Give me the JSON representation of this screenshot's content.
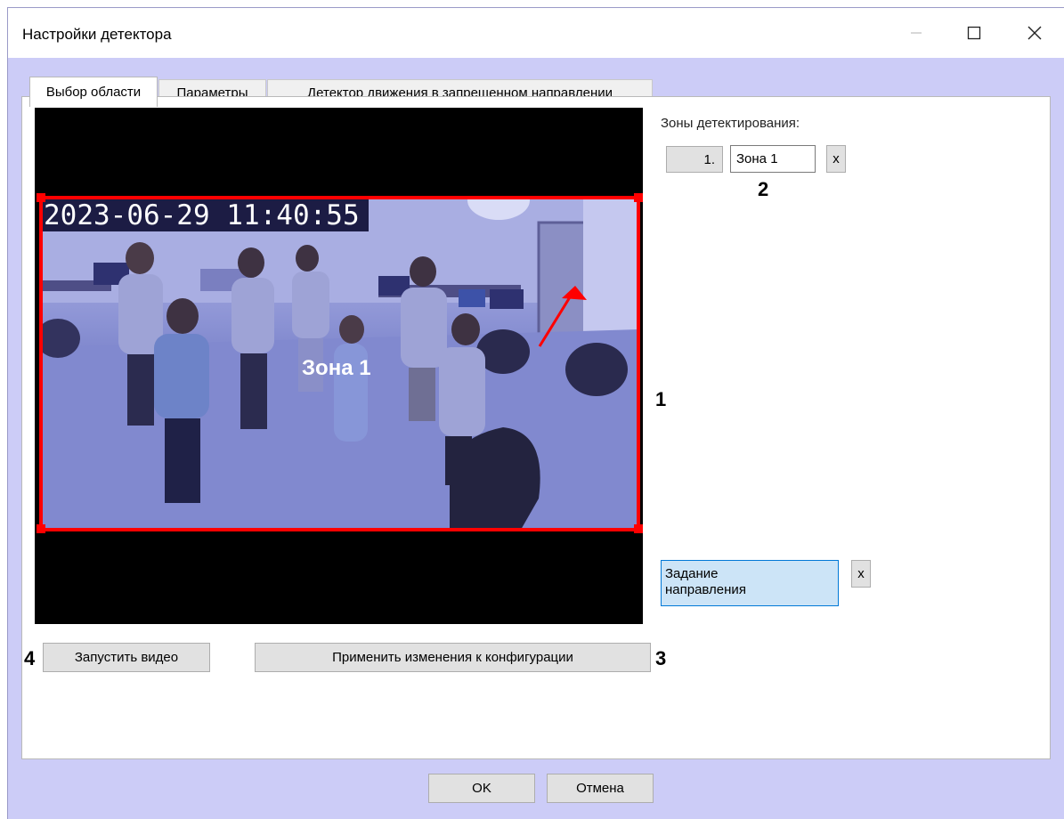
{
  "window": {
    "title": "Настройки детектора",
    "controls": {
      "minimize": "minimize-icon",
      "maximize": "maximize-icon",
      "close": "close-icon"
    }
  },
  "tabs": [
    {
      "label": "Выбор области",
      "active": true
    },
    {
      "label": "Параметры",
      "active": false
    },
    {
      "label": "Детектор движения в запрещенном направлении",
      "active": false
    }
  ],
  "video": {
    "timestamp": "2023-06-29  11:40:55",
    "zone_label": "Зона 1"
  },
  "zones": {
    "heading": "Зоны детектирования:",
    "items": [
      {
        "index": "1.",
        "name": "Зона 1",
        "delete_label": "x"
      }
    ]
  },
  "direction": {
    "line1": "Задание",
    "line2": "направления",
    "delete_label": "x"
  },
  "buttons": {
    "start_video": "Запустить видео",
    "apply": "Применить изменения к конфигурации",
    "ok": "OK",
    "cancel": "Отмена"
  },
  "callouts": {
    "c1": "1",
    "c2": "2",
    "c3": "3",
    "c4": "4"
  },
  "colors": {
    "zone_border": "#ff0000",
    "direction_arrow": "#ff0000",
    "window_bg": "#ccccf7",
    "selected_button": "#cce4f7"
  }
}
